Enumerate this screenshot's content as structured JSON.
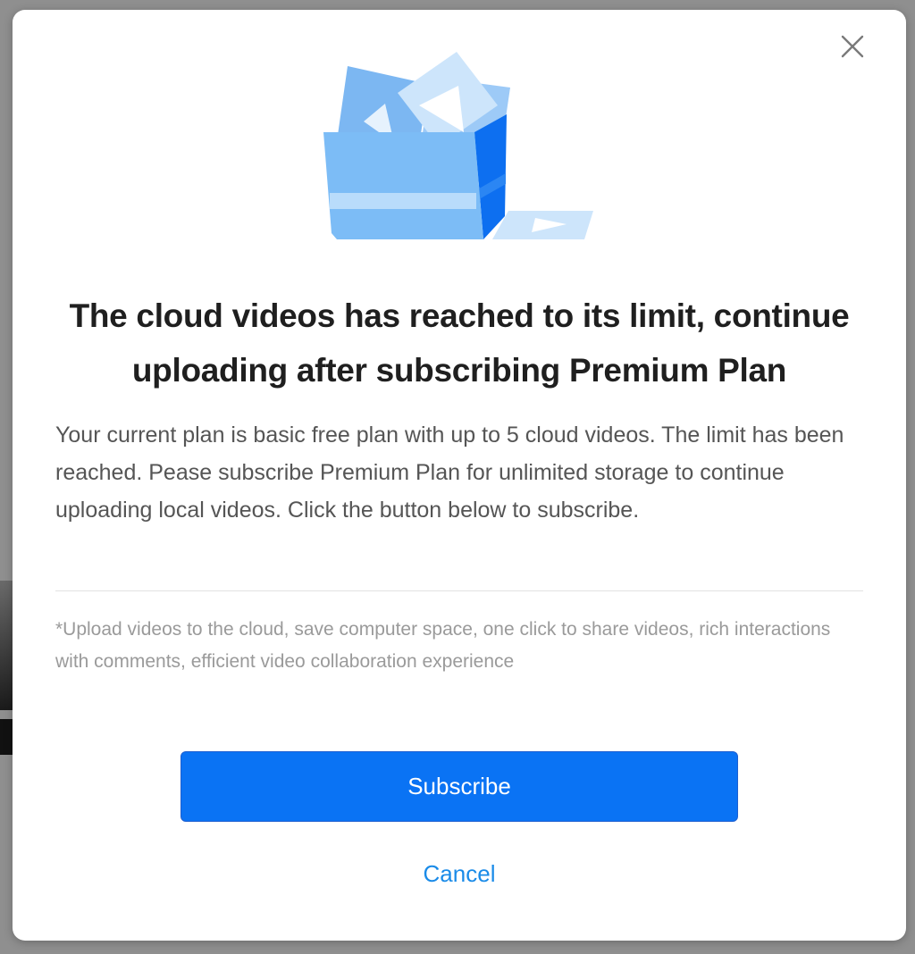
{
  "modal": {
    "title": "The cloud videos has reached to its limit, continue uploading after subscribing Premium Plan",
    "description": "Your current plan is basic free plan with up to 5 cloud videos. The limit has been reached. Pease subscribe Premium Plan for unlimited storage to continue uploading local videos. Click the button below to subscribe.",
    "footnote": "*Upload videos to the cloud, save computer space, one click to share videos, rich interactions with comments, efficient video collaboration experience",
    "subscribe_label": "Subscribe",
    "cancel_label": "Cancel",
    "close_icon": "close-icon",
    "illustration_icon": "video-box-illustration"
  },
  "colors": {
    "primary_button": "#0a73f4",
    "link": "#1a8be8",
    "title_text": "#1f1f1f",
    "body_text": "#555555",
    "footnote_text": "#9a9a9a",
    "backdrop": "#8f8f8f"
  }
}
